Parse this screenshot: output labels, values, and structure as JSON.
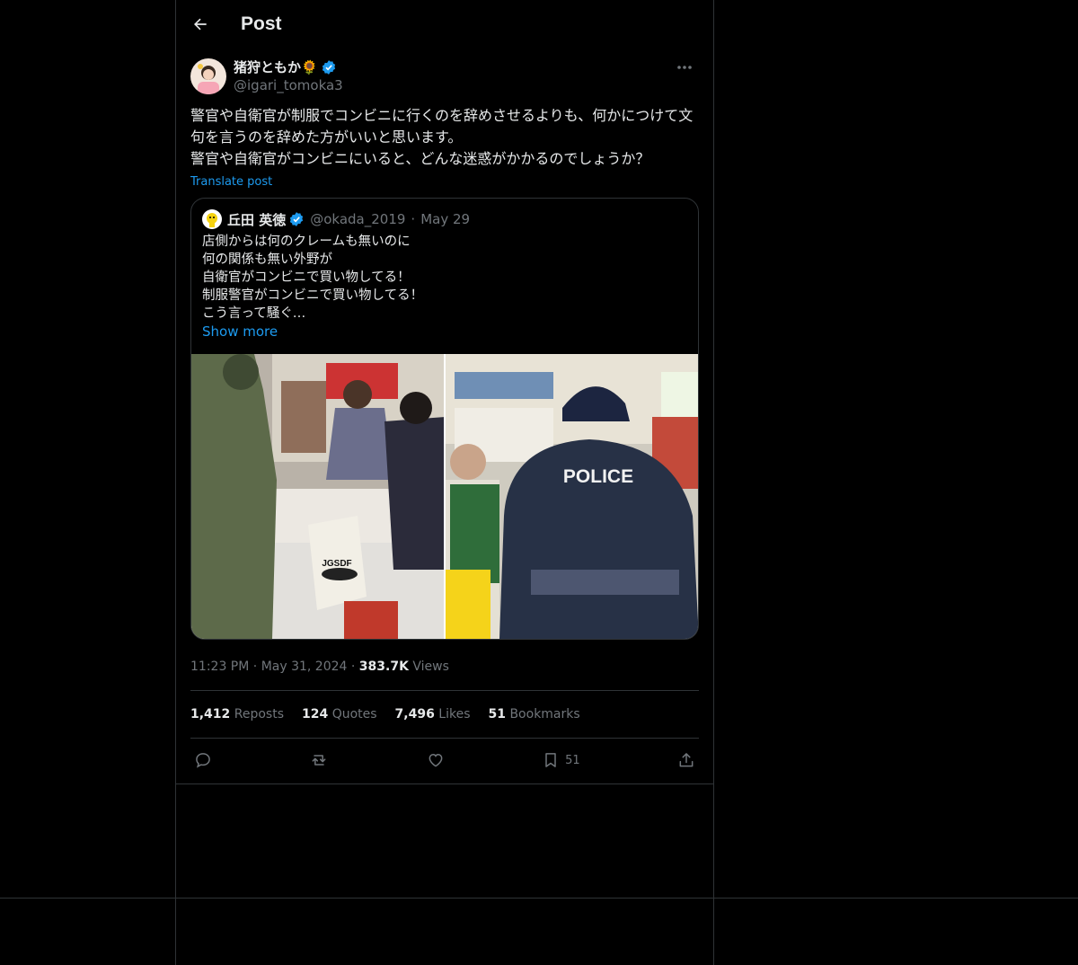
{
  "header": {
    "title": "Post"
  },
  "post": {
    "author_name": "猪狩ともか🌻",
    "author_handle": "@igari_tomoka3",
    "text": "警官や自衛官が制服でコンビニに行くのを辞めさせるよりも、何かにつけて文句を言うのを辞めた方がいいと思います。\n警官や自衛官がコンビニにいると、どんな迷惑がかかるのでしょうか？",
    "translate_label": "Translate post",
    "time": "11:23 PM",
    "date": "May 31, 2024",
    "views_count": "383.7K",
    "views_label": "Views"
  },
  "quote": {
    "author_name": "丘田 英徳",
    "author_handle": "@okada_2019",
    "date": "May 29",
    "text": "店側からは何のクレームも無いのに\n何の関係も無い外野が\n自衛官がコンビニで買い物してる！\n制服警官がコンビニで買い物してる！\nこう言って騒ぐ…",
    "show_more": "Show more",
    "photo1_text": "JGSDF",
    "photo2_text": "POLICE"
  },
  "stats": {
    "reposts_count": "1,412",
    "reposts_label": "Reposts",
    "quotes_count": "124",
    "quotes_label": "Quotes",
    "likes_count": "7,496",
    "likes_label": "Likes",
    "bookmarks_count": "51",
    "bookmarks_label": "Bookmarks"
  },
  "actions": {
    "bookmark_count": "51"
  },
  "colors": {
    "accent": "#1d9bf0",
    "muted": "#71767b",
    "border": "#2f3336",
    "text": "#e7e9ea",
    "background": "#000000"
  },
  "icons": [
    "back-arrow-icon",
    "verified-badge-icon",
    "more-icon",
    "reply-icon",
    "repost-icon",
    "like-icon",
    "bookmark-icon",
    "share-icon"
  ]
}
